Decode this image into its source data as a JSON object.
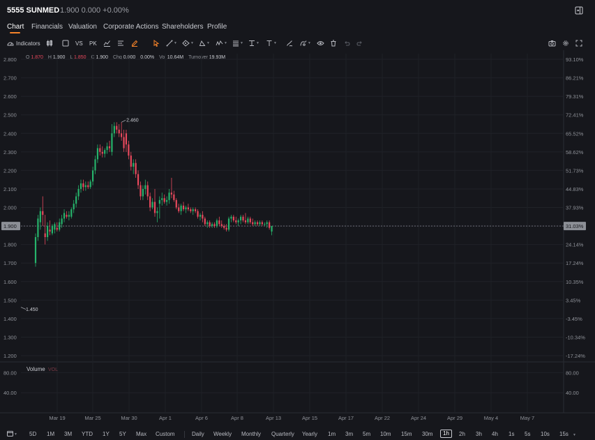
{
  "header": {
    "symbol": "5555 SUNMED",
    "price_line": "1.900  0.000  +0.00%"
  },
  "tabs": [
    "Chart",
    "Financials",
    "Valuation",
    "Corporate Actions",
    "Shareholders",
    "Profile"
  ],
  "toolbar": {
    "indicators_label": "Indicators",
    "vs_label": "VS",
    "pk_label": "PK"
  },
  "ohlc": {
    "o_label": "O",
    "o_value": "1.870",
    "h_label": "H",
    "h_value": "1.900",
    "l_label": "L",
    "l_value": "1.850",
    "c_label": "C",
    "c_value": "1.900",
    "chg_label": "Chg",
    "chg_value": "0.000",
    "chg_pct": "0.00%",
    "vol_label": "Vol",
    "vol_value": "10.64M",
    "turnover_label": "Turnover",
    "turnover_value": "19.93M"
  },
  "volume_pane": {
    "title": "Volume",
    "indicator": "VOL"
  },
  "colors": {
    "up": "#26b36b",
    "down": "#e8495d",
    "accent": "#f5832a",
    "background": "#16171c"
  },
  "chart_data": {
    "type": "candlestick",
    "current_price": 1.9,
    "current_price_label": "1.900",
    "current_pct_label": "31.03%",
    "high_annotation": {
      "value": 2.46,
      "label": "2.460",
      "candle_index": 36
    },
    "low_annotation": {
      "value": 1.45,
      "label": "1.450"
    },
    "y_ticks": [
      "2.800",
      "2.700",
      "2.600",
      "2.500",
      "2.400",
      "2.300",
      "2.200",
      "2.100",
      "2.000",
      "1.900",
      "1.800",
      "1.700",
      "1.600",
      "1.500",
      "1.400",
      "1.300",
      "1.200"
    ],
    "ylim": [
      1.2,
      2.8
    ],
    "pct_ticks": [
      "93.10%",
      "86.21%",
      "79.31%",
      "72.41%",
      "65.52%",
      "58.62%",
      "51.73%",
      "44.83%",
      "37.93%",
      "31.03%",
      "24.14%",
      "17.24%",
      "10.35%",
      "3.45%",
      "-3.45%",
      "-10.34%",
      "-17.24%"
    ],
    "volume_ticks": [
      "80.00",
      "40.00"
    ],
    "volume_ylim": [
      0,
      100
    ],
    "x_labels": [
      "Mar 19",
      "Mar 25",
      "Mar 30",
      "Apr 1",
      "Apr 6",
      "Apr 8",
      "Apr 13",
      "Apr 15",
      "Apr 17",
      "Apr 22",
      "Apr 24",
      "Apr 29",
      "May 4",
      "May 7"
    ],
    "candles": [
      [
        1.7,
        1.86,
        1.68,
        1.84
      ],
      [
        1.84,
        1.96,
        1.82,
        1.94
      ],
      [
        1.92,
        2.0,
        1.88,
        1.98
      ],
      [
        1.98,
        2.06,
        1.9,
        1.96
      ],
      [
        1.86,
        1.96,
        1.8,
        1.84
      ],
      [
        1.84,
        1.92,
        1.82,
        1.9
      ],
      [
        1.88,
        1.93,
        1.85,
        1.87
      ],
      [
        1.86,
        1.91,
        1.85,
        1.9
      ],
      [
        1.88,
        1.92,
        1.86,
        1.91
      ],
      [
        1.89,
        1.92,
        1.87,
        1.88
      ],
      [
        1.88,
        1.94,
        1.87,
        1.92
      ],
      [
        1.91,
        1.96,
        1.89,
        1.94
      ],
      [
        1.94,
        1.99,
        1.92,
        1.97
      ],
      [
        1.96,
        1.98,
        1.94,
        1.95
      ],
      [
        1.95,
        1.98,
        1.93,
        1.96
      ],
      [
        1.95,
        2.0,
        1.94,
        1.99
      ],
      [
        1.99,
        2.04,
        1.97,
        2.02
      ],
      [
        2.02,
        2.08,
        2.0,
        2.06
      ],
      [
        2.06,
        2.12,
        2.04,
        2.1
      ],
      [
        2.1,
        2.15,
        2.08,
        2.13
      ],
      [
        2.13,
        2.15,
        2.09,
        2.11
      ],
      [
        2.11,
        2.14,
        2.09,
        2.12
      ],
      [
        2.12,
        2.14,
        2.1,
        2.11
      ],
      [
        2.11,
        2.15,
        2.1,
        2.14
      ],
      [
        2.14,
        2.22,
        2.12,
        2.2
      ],
      [
        2.2,
        2.28,
        2.18,
        2.26
      ],
      [
        2.26,
        2.34,
        2.24,
        2.32
      ],
      [
        2.32,
        2.34,
        2.28,
        2.3
      ],
      [
        2.3,
        2.33,
        2.27,
        2.29
      ],
      [
        2.29,
        2.32,
        2.27,
        2.31
      ],
      [
        2.31,
        2.35,
        2.29,
        2.33
      ],
      [
        2.33,
        2.36,
        2.3,
        2.32
      ],
      [
        2.3,
        2.45,
        2.28,
        2.4
      ],
      [
        2.4,
        2.46,
        2.38,
        2.44
      ],
      [
        2.44,
        2.46,
        2.4,
        2.42
      ],
      [
        2.42,
        2.45,
        2.38,
        2.4
      ],
      [
        2.4,
        2.46,
        2.36,
        2.38
      ],
      [
        2.38,
        2.42,
        2.3,
        2.32
      ],
      [
        2.4,
        2.42,
        2.3,
        2.34
      ],
      [
        2.34,
        2.36,
        2.26,
        2.28
      ],
      [
        2.28,
        2.3,
        2.2,
        2.22
      ],
      [
        2.22,
        2.26,
        2.18,
        2.24
      ],
      [
        2.24,
        2.26,
        2.16,
        2.18
      ],
      [
        2.18,
        2.2,
        2.1,
        2.12
      ],
      [
        2.12,
        2.14,
        2.04,
        2.06
      ],
      [
        2.06,
        2.12,
        2.04,
        2.1
      ],
      [
        2.1,
        2.15,
        2.07,
        2.12
      ],
      [
        2.12,
        2.14,
        2.04,
        2.06
      ],
      [
        2.06,
        2.08,
        1.98,
        2.0
      ],
      [
        2.0,
        2.05,
        1.99,
        2.03
      ],
      [
        2.03,
        2.1,
        1.95,
        1.97
      ],
      [
        1.97,
        2.0,
        1.92,
        1.98
      ],
      [
        2.02,
        2.06,
        1.94,
        2.04
      ],
      [
        2.04,
        2.08,
        2.01,
        2.05
      ],
      [
        2.05,
        2.07,
        2.02,
        2.03
      ],
      [
        2.03,
        2.06,
        2.01,
        2.04
      ],
      [
        2.04,
        2.1,
        2.02,
        2.08
      ],
      [
        2.08,
        2.16,
        2.05,
        2.07
      ],
      [
        2.07,
        2.09,
        2.03,
        2.04
      ],
      [
        2.04,
        2.05,
        1.99,
        2.0
      ],
      [
        2.0,
        2.02,
        1.97,
        1.98
      ],
      [
        1.98,
        2.02,
        1.96,
        2.01
      ],
      [
        2.01,
        2.03,
        1.98,
        1.99
      ],
      [
        1.99,
        2.01,
        1.97,
        2.0
      ],
      [
        2.0,
        2.02,
        1.98,
        1.99
      ],
      [
        1.99,
        2.0,
        1.97,
        1.98
      ],
      [
        1.98,
        2.0,
        1.96,
        1.99
      ],
      [
        1.99,
        2.0,
        1.97,
        1.98
      ],
      [
        1.98,
        1.99,
        1.94,
        1.95
      ],
      [
        1.95,
        1.97,
        1.93,
        1.96
      ],
      [
        1.96,
        1.98,
        1.92,
        1.94
      ],
      [
        1.94,
        1.95,
        1.9,
        1.91
      ],
      [
        1.91,
        1.93,
        1.89,
        1.92
      ],
      [
        1.92,
        1.93,
        1.89,
        1.9
      ],
      [
        1.9,
        1.92,
        1.89,
        1.91
      ],
      [
        1.91,
        1.92,
        1.89,
        1.9
      ],
      [
        1.9,
        1.94,
        1.89,
        1.93
      ],
      [
        1.93,
        1.95,
        1.9,
        1.91
      ],
      [
        1.91,
        1.93,
        1.89,
        1.9
      ],
      [
        1.9,
        1.91,
        1.88,
        1.89
      ],
      [
        1.89,
        1.91,
        1.87,
        1.88
      ],
      [
        1.88,
        1.95,
        1.87,
        1.94
      ],
      [
        1.94,
        1.96,
        1.92,
        1.95
      ],
      [
        1.95,
        1.96,
        1.92,
        1.93
      ],
      [
        1.93,
        1.95,
        1.91,
        1.92
      ],
      [
        1.92,
        1.94,
        1.9,
        1.93
      ],
      [
        1.93,
        1.96,
        1.91,
        1.95
      ],
      [
        1.95,
        1.96,
        1.92,
        1.93
      ],
      [
        1.93,
        1.97,
        1.91,
        1.92
      ],
      [
        1.92,
        1.95,
        1.91,
        1.94
      ],
      [
        1.94,
        1.95,
        1.91,
        1.92
      ],
      [
        1.92,
        1.94,
        1.9,
        1.91
      ],
      [
        1.91,
        1.93,
        1.9,
        1.92
      ],
      [
        1.92,
        1.93,
        1.9,
        1.91
      ],
      [
        1.91,
        1.93,
        1.9,
        1.92
      ],
      [
        1.92,
        1.93,
        1.9,
        1.91
      ],
      [
        1.91,
        1.92,
        1.9,
        1.91
      ],
      [
        1.91,
        1.93,
        1.89,
        1.92
      ],
      [
        1.92,
        1.93,
        1.88,
        1.89
      ],
      [
        1.87,
        1.9,
        1.85,
        1.9
      ]
    ]
  },
  "bottom": {
    "interval_selector": "1h",
    "ranges": [
      "5D",
      "1M",
      "3M",
      "YTD",
      "1Y",
      "5Y",
      "Max",
      "Custom"
    ],
    "periods": [
      "Daily",
      "Weekly",
      "Monthly",
      "Quarterly",
      "Yearly"
    ],
    "intervals": [
      "1m",
      "3m",
      "5m",
      "10m",
      "15m",
      "30m",
      "1h",
      "2h",
      "3h",
      "4h",
      "1s",
      "5s",
      "10s",
      "15s"
    ],
    "active_interval": "1h"
  }
}
